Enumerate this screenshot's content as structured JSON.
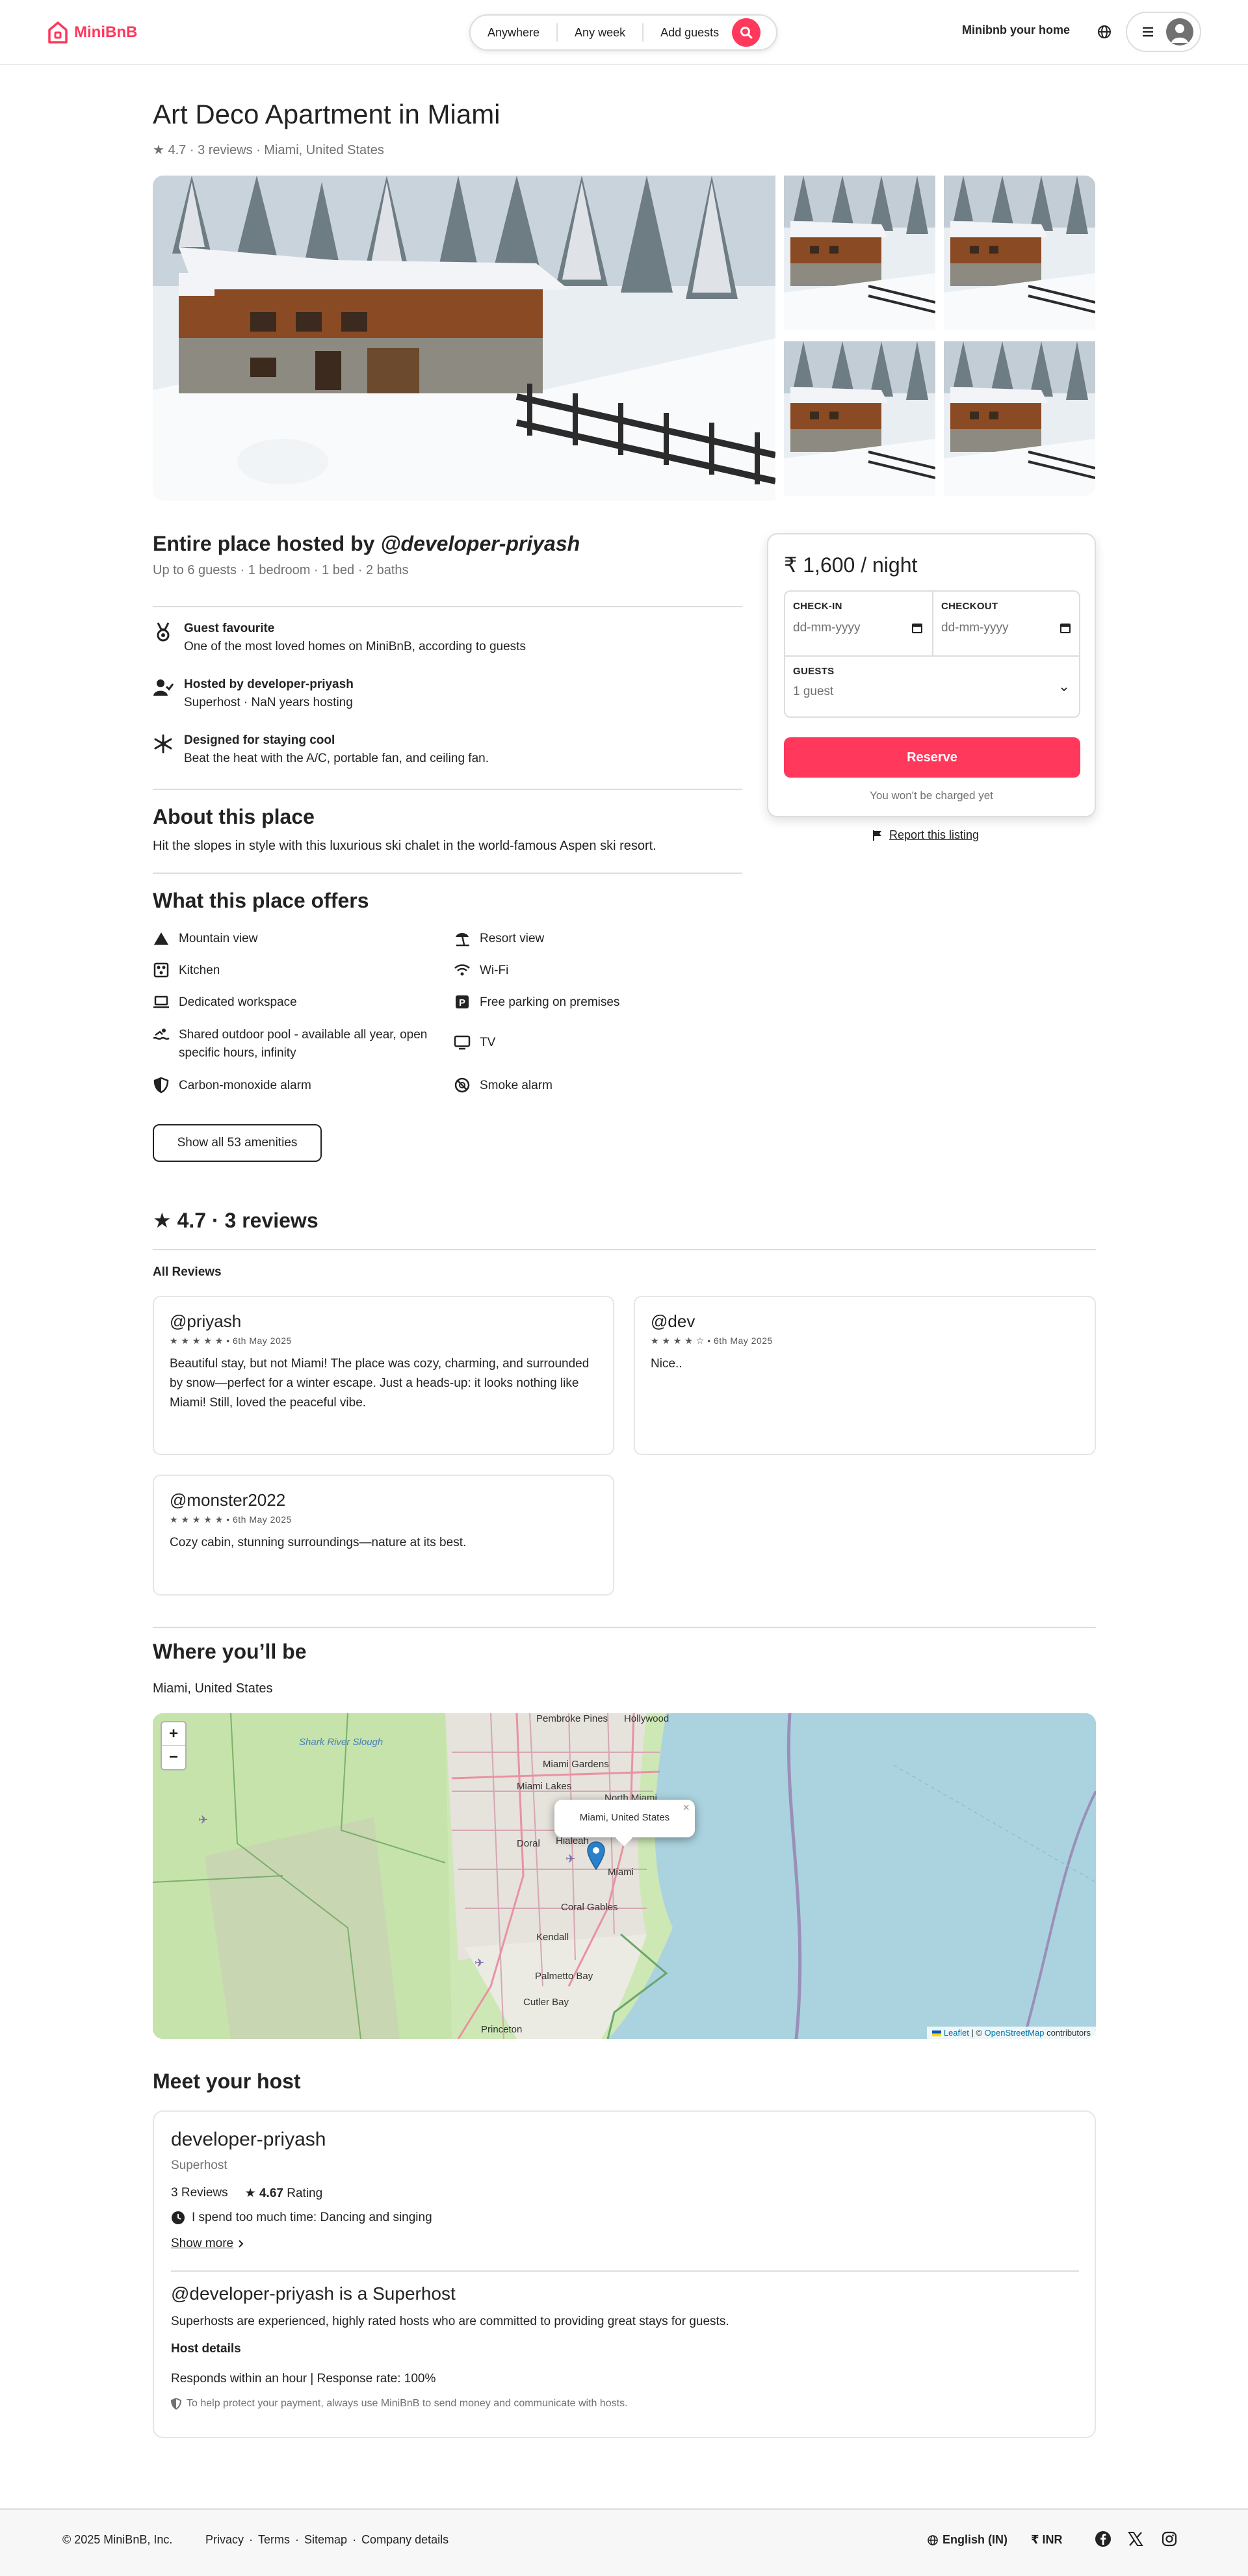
{
  "brand": {
    "name": "MiniBnB",
    "accent_color": "#ff385c"
  },
  "header": {
    "search": {
      "where": "Anywhere",
      "when": "Any week",
      "who": "Add guests"
    },
    "host_link": "Minibnb your home",
    "icons": [
      "globe-icon",
      "menu-icon",
      "user-avatar-icon",
      "search-icon"
    ]
  },
  "listing": {
    "title": "Art Deco Apartment in Miami",
    "subtitle": "★ 4.7 · 3 reviews · Miami, United States",
    "host_heading_prefix": "Entire place hosted by ",
    "host_handle": "@developer-priyash",
    "specs": "Up to 6 guests · 1 bedroom · 1 bed · 2 baths"
  },
  "features": [
    {
      "icon": "medal-icon",
      "title": "Guest favourite",
      "desc": "One of the most loved homes on MiniBnB, according to guests"
    },
    {
      "icon": "user-check-icon",
      "title": "Hosted by developer-priyash",
      "desc": "Superhost · NaN years hosting"
    },
    {
      "icon": "snowflake-icon",
      "title": "Designed for staying cool",
      "desc": "Beat the heat with the A/C, portable fan, and ceiling fan."
    }
  ],
  "about": {
    "heading": "About this place",
    "text": "Hit the slopes in style with this luxurious ski chalet in the world-famous Aspen ski resort."
  },
  "amenities": {
    "heading": "What this place offers",
    "items": [
      {
        "icon": "mountain-icon",
        "label": "Mountain view"
      },
      {
        "icon": "beach-umbrella-icon",
        "label": "Resort view"
      },
      {
        "icon": "kitchen-icon",
        "label": "Kitchen"
      },
      {
        "icon": "wifi-icon",
        "label": "Wi-Fi"
      },
      {
        "icon": "laptop-icon",
        "label": "Dedicated workspace"
      },
      {
        "icon": "parking-icon",
        "label": "Free parking on premises"
      },
      {
        "icon": "pool-icon",
        "label": "Shared outdoor pool - available all year, open specific hours, infinity"
      },
      {
        "icon": "tv-icon",
        "label": "TV"
      },
      {
        "icon": "shield-icon",
        "label": "Carbon-monoxide alarm"
      },
      {
        "icon": "smoke-alarm-icon",
        "label": "Smoke alarm"
      }
    ],
    "show_all": "Show all 53 amenities"
  },
  "booking": {
    "price": "₹ 1,600 / night",
    "checkin_label": "CHECK-IN",
    "checkout_label": "CHECKOUT",
    "date_placeholder": "dd-mm-yyyy",
    "guests_label": "GUESTS",
    "guests_value": "1 guest",
    "reserve": "Reserve",
    "note": "You won't be charged yet",
    "report": "Report this listing"
  },
  "reviews": {
    "heading": "★ 4.7 · 3 reviews",
    "all_label": "All Reviews",
    "items": [
      {
        "user": "@priyash",
        "meta": "★ ★ ★ ★ ★ • 6th May 2025",
        "rating": 5,
        "text": "Beautiful stay, but not Miami! The place was cozy, charming, and surrounded by snow—perfect for a winter escape. Just a heads-up: it looks nothing like Miami! Still, loved the peaceful vibe."
      },
      {
        "user": "@dev",
        "meta": "★ ★ ★ ★ ☆ • 6th May 2025",
        "rating": 4,
        "text": "Nice.."
      },
      {
        "user": "@monster2022",
        "meta": "★ ★ ★ ★ ★ • 6th May 2025",
        "rating": 5,
        "text": "Cozy cabin, stunning surroundings—nature at its best."
      }
    ]
  },
  "location": {
    "heading": "Where you’ll be",
    "place": "Miami, United States",
    "popup": "Miami, United States",
    "popup_close": "×",
    "zoom_in": "+",
    "zoom_out": "−",
    "attribution_leaflet": "Leaflet",
    "attribution_sep": " | © ",
    "attribution_osm": "OpenStreetMap",
    "attribution_tail": " contributors",
    "labels": [
      "Shark River Slough",
      "Pembroke Pines",
      "Hollywood",
      "Miami Gardens",
      "Miami Lakes",
      "North Miami",
      "Hialeah",
      "Doral",
      "Miami",
      "Coral Gables",
      "Kendall",
      "Palmetto Bay",
      "Cutler Bay",
      "Princeton"
    ]
  },
  "host": {
    "heading": "Meet your host",
    "name": "developer-priyash",
    "role": "Superhost",
    "reviews_count": "3",
    "reviews_label": "Reviews",
    "rating": "★ 4.67",
    "rating_label": "Rating",
    "fun_fact": "I spend too much time: Dancing and singing",
    "show_more": "Show more",
    "superhost_title": "@developer-priyash is a Superhost",
    "superhost_desc": "Superhosts are experienced, highly rated hosts who are committed to providing great stays for guests.",
    "details_label": "Host details",
    "response": "Responds within an hour | Response rate: 100%",
    "protect": "To help protect your payment, always use MiniBnB to send money and communicate with hosts."
  },
  "footer": {
    "copyright": "© 2025 MiniBnB, Inc.",
    "links": [
      "Privacy",
      "Terms",
      "Sitemap",
      "Company details"
    ],
    "language": "English (IN)",
    "currency": "₹ INR",
    "social": [
      "facebook-icon",
      "x-icon",
      "instagram-icon"
    ]
  }
}
